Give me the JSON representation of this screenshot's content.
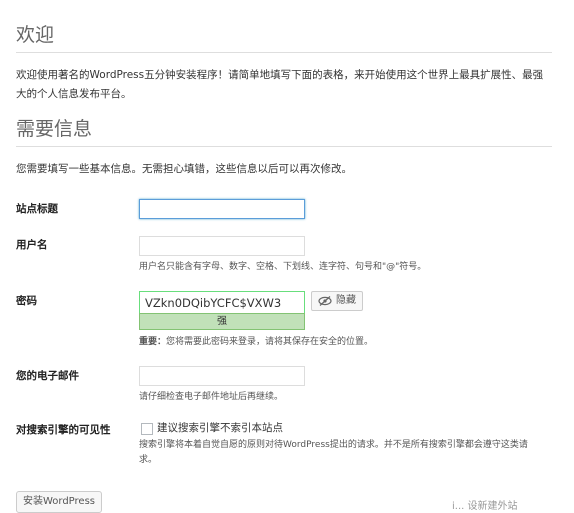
{
  "welcome": {
    "title": "欢迎",
    "text_line1": "欢迎使用著名的WordPress五分钟安装程序！请简单地填写下面的表格，来开始使用这个世界上最具扩展性、最强",
    "text_line2": "大的个人信息发布平台。"
  },
  "info": {
    "title": "需要信息",
    "intro": "您需要填写一些基本信息。无需担心填错，这些信息以后可以再次修改。"
  },
  "form": {
    "site_title_label": "站点标题",
    "site_title_value": "",
    "username_label": "用户名",
    "username_value": "",
    "username_hint": "用户名只能含有字母、数字、空格、下划线、连字符、句号和\"@\"符号。",
    "password_label": "密码",
    "password_value": "VZkn0DQibYCFC$VXW3",
    "password_strength": "强",
    "hide_button_label": "隐藏",
    "password_note_strong": "重要：",
    "password_note": "您将需要此密码来登录，请将其保存在安全的位置。",
    "email_label": "您的电子邮件",
    "email_value": "",
    "email_hint": "请仔细检查电子邮件地址后再继续。",
    "visibility_label": "对搜索引擎的可见性",
    "visibility_checkbox_label": "建议搜索引擎不索引本站点",
    "visibility_hint_line1": "搜索引擎将本着自觉自愿的原则对待WordPress提出的请求。并不是所有搜索引擎都会遵守这类请",
    "visibility_hint_line2": "求。",
    "visibility_checked": false
  },
  "install_button_label": "安装WordPress",
  "watermark": "i... 设新建外站"
}
